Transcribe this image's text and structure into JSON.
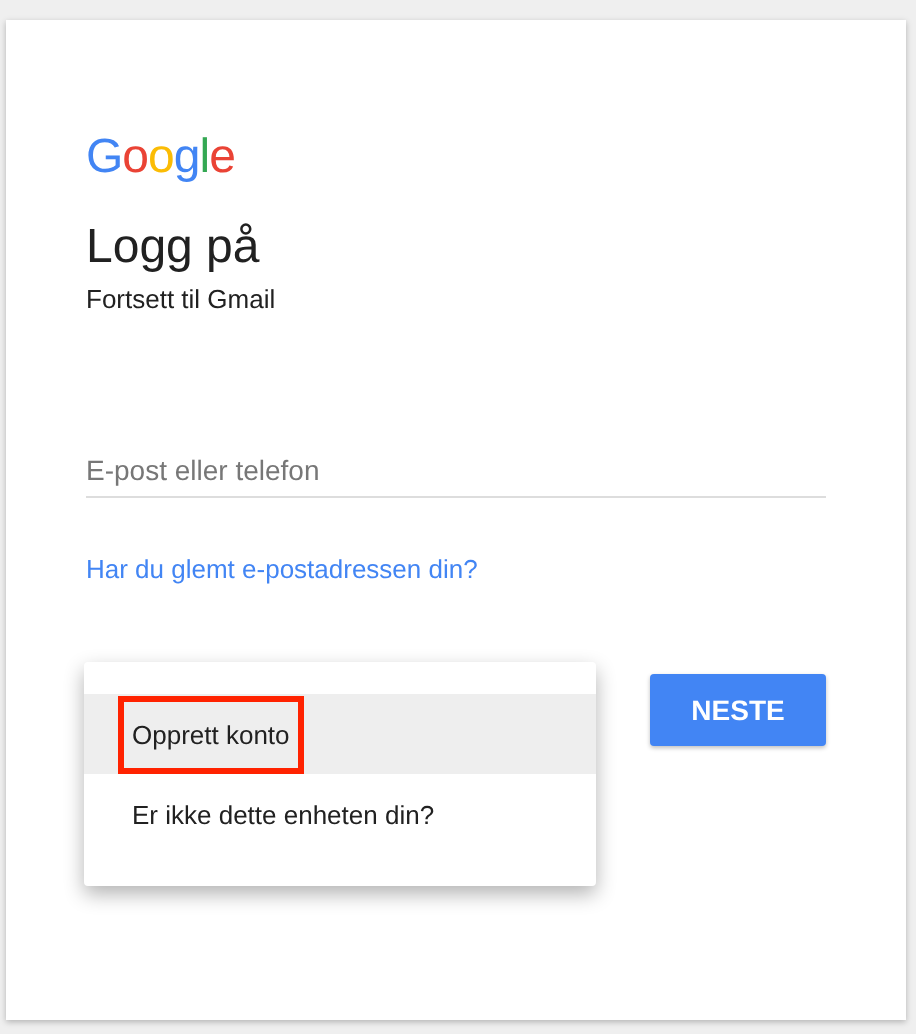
{
  "logo": "Google",
  "title": "Logg på",
  "subtitle": "Fortsett til Gmail",
  "email_field": {
    "placeholder": "E-post eller telefon"
  },
  "forgot_link": "Har du glemt e-postadressen din?",
  "menu": {
    "items": [
      {
        "label": "Opprett konto",
        "selected": true,
        "highlighted": true
      },
      {
        "label": "Er ikke dette enheten din?",
        "selected": false,
        "highlighted": false
      }
    ]
  },
  "next_button": "NESTE"
}
